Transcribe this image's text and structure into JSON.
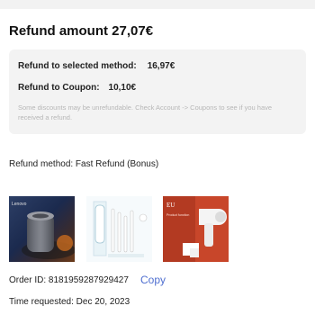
{
  "refund": {
    "title": "Refund amount 27,07€",
    "selected_label": "Refund to selected method:",
    "selected_value": "16,97€",
    "coupon_label": "Refund to Coupon:",
    "coupon_value": "10,10€",
    "note": "Some discounts may be unrefundable. Check Account -> Coupons to see if you have received a refund."
  },
  "method": {
    "text": "Refund method: Fast Refund (Bonus)"
  },
  "products": [
    {
      "name": "lenovo-speaker-image",
      "badge": "Lenovo"
    },
    {
      "name": "toothbrush-kit-image"
    },
    {
      "name": "hair-dryer-image",
      "badge": "EU",
      "caption": "Product function"
    }
  ],
  "order": {
    "id_text": "Order ID: 8181959287929427",
    "copy_label": "Copy",
    "time_text": "Time requested: Dec 20, 2023"
  },
  "colors": {
    "accent": "#4f6fd0",
    "card_bg": "#f3f3f3",
    "note_text": "#b7b7b7"
  }
}
